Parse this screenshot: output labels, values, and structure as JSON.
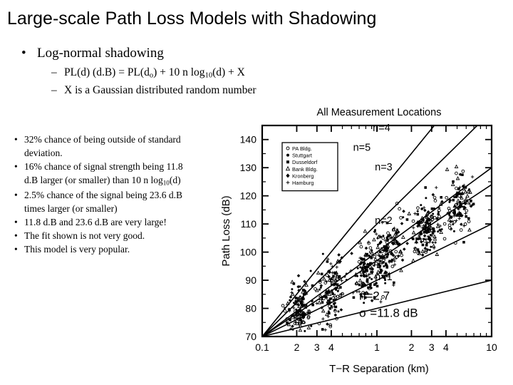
{
  "slide": {
    "title": "Large-scale Path Loss Models with Shadowing",
    "bullet_level1": "Log-normal shadowing",
    "sub_bullets": [
      "PL(d) (d.B) = PL(do) + 10 n log10(d) + X",
      "X is a Gaussian distributed random number"
    ],
    "notes": [
      "32% chance of being outside of standard deviation.",
      "16% chance of signal strength being 11.8 d.B larger (or smaller) than 10 n log10(d)",
      "2.5% chance of the signal being 23.6 d.B times larger (or smaller)",
      "11.8 d.B and 23.6 d.B are very large!",
      "The fit shown is not very good.",
      "This model is very popular."
    ],
    "bullet_marker_l1": "•",
    "bullet_marker_l2": "–",
    "bullet_marker_notes": "•"
  },
  "chart_data": {
    "type": "scatter",
    "title": "All Measurement Locations",
    "xlabel": "T−R Separation (km)",
    "ylabel": "Path Loss (dB)",
    "xscale": "log",
    "xlim": [
      0.1,
      10
    ],
    "ylim": [
      70,
      145
    ],
    "xticks": [
      "0.1",
      "2",
      "3",
      "4",
      "1",
      "2",
      "3",
      "4",
      "10"
    ],
    "yticks": [
      "70",
      "80",
      "90",
      "100",
      "110",
      "120",
      "130",
      "140"
    ],
    "grid": false,
    "legend_position": "upper-left-inset",
    "legend": [
      "PA Bldg.",
      "Stuttgart",
      "Dusseldorf",
      "Bank Bldg.",
      "Kronberg",
      "Hamburg"
    ],
    "annotations": [
      {
        "label": "n=4",
        "x": 0.92,
        "y": 143
      },
      {
        "label": "n=5",
        "x": 0.62,
        "y": 136
      },
      {
        "label": "n=3",
        "x": 0.96,
        "y": 129
      },
      {
        "label": "n=2",
        "x": 0.96,
        "y": 110
      },
      {
        "label": "n=1",
        "x": 0.96,
        "y": 90
      },
      {
        "label": "n=2.7",
        "x": 0.7,
        "y": 83
      },
      {
        "label": "σ =11.8 dB",
        "x": 0.7,
        "y": 77
      }
    ],
    "fit_lines": [
      {
        "n": 1,
        "slope_db_per_decade": 10
      },
      {
        "n": 2,
        "slope_db_per_decade": 20
      },
      {
        "n": 2.7,
        "slope_db_per_decade": 27
      },
      {
        "n": 3,
        "slope_db_per_decade": 30
      },
      {
        "n": 4,
        "slope_db_per_decade": 40
      },
      {
        "n": 5,
        "slope_db_per_decade": 50
      }
    ],
    "reference_point": {
      "x": 0.1,
      "y": 70
    }
  }
}
